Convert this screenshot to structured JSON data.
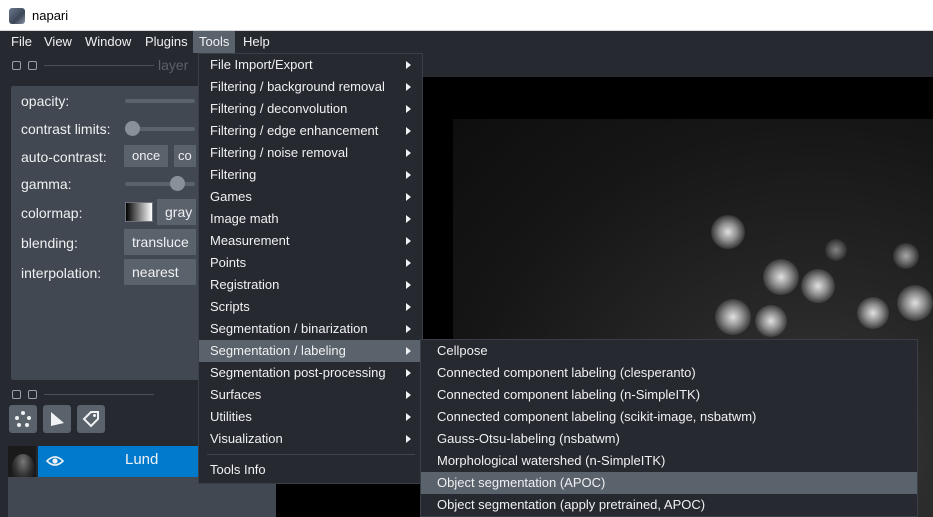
{
  "window": {
    "title": "napari"
  },
  "menubar": {
    "items": [
      {
        "label": "File"
      },
      {
        "label": "View"
      },
      {
        "label": "Window"
      },
      {
        "label": "Plugins"
      },
      {
        "label": "Tools",
        "active": true
      },
      {
        "label": "Help"
      }
    ]
  },
  "dock": {
    "title_fragment": "layer",
    "controls": {
      "opacity_label": "opacity:",
      "contrast_label": "contrast limits:",
      "auto_contrast_label": "auto-contrast:",
      "auto_contrast_once": "once",
      "auto_contrast_continuous_fragment": "co",
      "gamma_label": "gamma:",
      "colormap_label": "colormap:",
      "colormap_value_fragment": "gray",
      "blending_label": "blending:",
      "blending_value_fragment": "transluce",
      "interpolation_label": "interpolation:",
      "interpolation_value": "nearest"
    },
    "layers": [
      {
        "name": "Lund",
        "visible": true,
        "selected": true
      }
    ]
  },
  "tools_menu": {
    "items": [
      {
        "label": "File Import/Export",
        "submenu": true
      },
      {
        "label": "Filtering / background removal",
        "submenu": true
      },
      {
        "label": "Filtering / deconvolution",
        "submenu": true
      },
      {
        "label": "Filtering / edge enhancement",
        "submenu": true
      },
      {
        "label": "Filtering / noise removal",
        "submenu": true
      },
      {
        "label": "Filtering",
        "submenu": true
      },
      {
        "label": "Games",
        "submenu": true
      },
      {
        "label": "Image math",
        "submenu": true
      },
      {
        "label": "Measurement",
        "submenu": true
      },
      {
        "label": "Points",
        "submenu": true
      },
      {
        "label": "Registration",
        "submenu": true
      },
      {
        "label": "Scripts",
        "submenu": true
      },
      {
        "label": "Segmentation / binarization",
        "submenu": true
      },
      {
        "label": "Segmentation / labeling",
        "submenu": true,
        "highlighted": true
      },
      {
        "label": "Segmentation post-processing",
        "submenu": true
      },
      {
        "label": "Surfaces",
        "submenu": true
      },
      {
        "label": "Utilities",
        "submenu": true
      },
      {
        "label": "Visualization",
        "submenu": true
      }
    ],
    "footer_item": "Tools Info"
  },
  "labeling_submenu": {
    "items": [
      {
        "label": "Cellpose"
      },
      {
        "label": "Connected component labeling (clesperanto)"
      },
      {
        "label": "Connected component labeling (n-SimpleITK)"
      },
      {
        "label": "Connected component labeling (scikit-image, nsbatwm)"
      },
      {
        "label": "Gauss-Otsu-labeling (nsbatwm)"
      },
      {
        "label": "Morphological watershed (n-SimpleITK)"
      },
      {
        "label": "Object segmentation (APOC)",
        "highlighted": true
      },
      {
        "label": "Object segmentation (apply pretrained, APOC)"
      }
    ]
  },
  "colors": {
    "background": "#262930",
    "panel": "#414851",
    "highlight": "#5a626c",
    "selection": "#007acc",
    "text": "#f0f1f2"
  }
}
